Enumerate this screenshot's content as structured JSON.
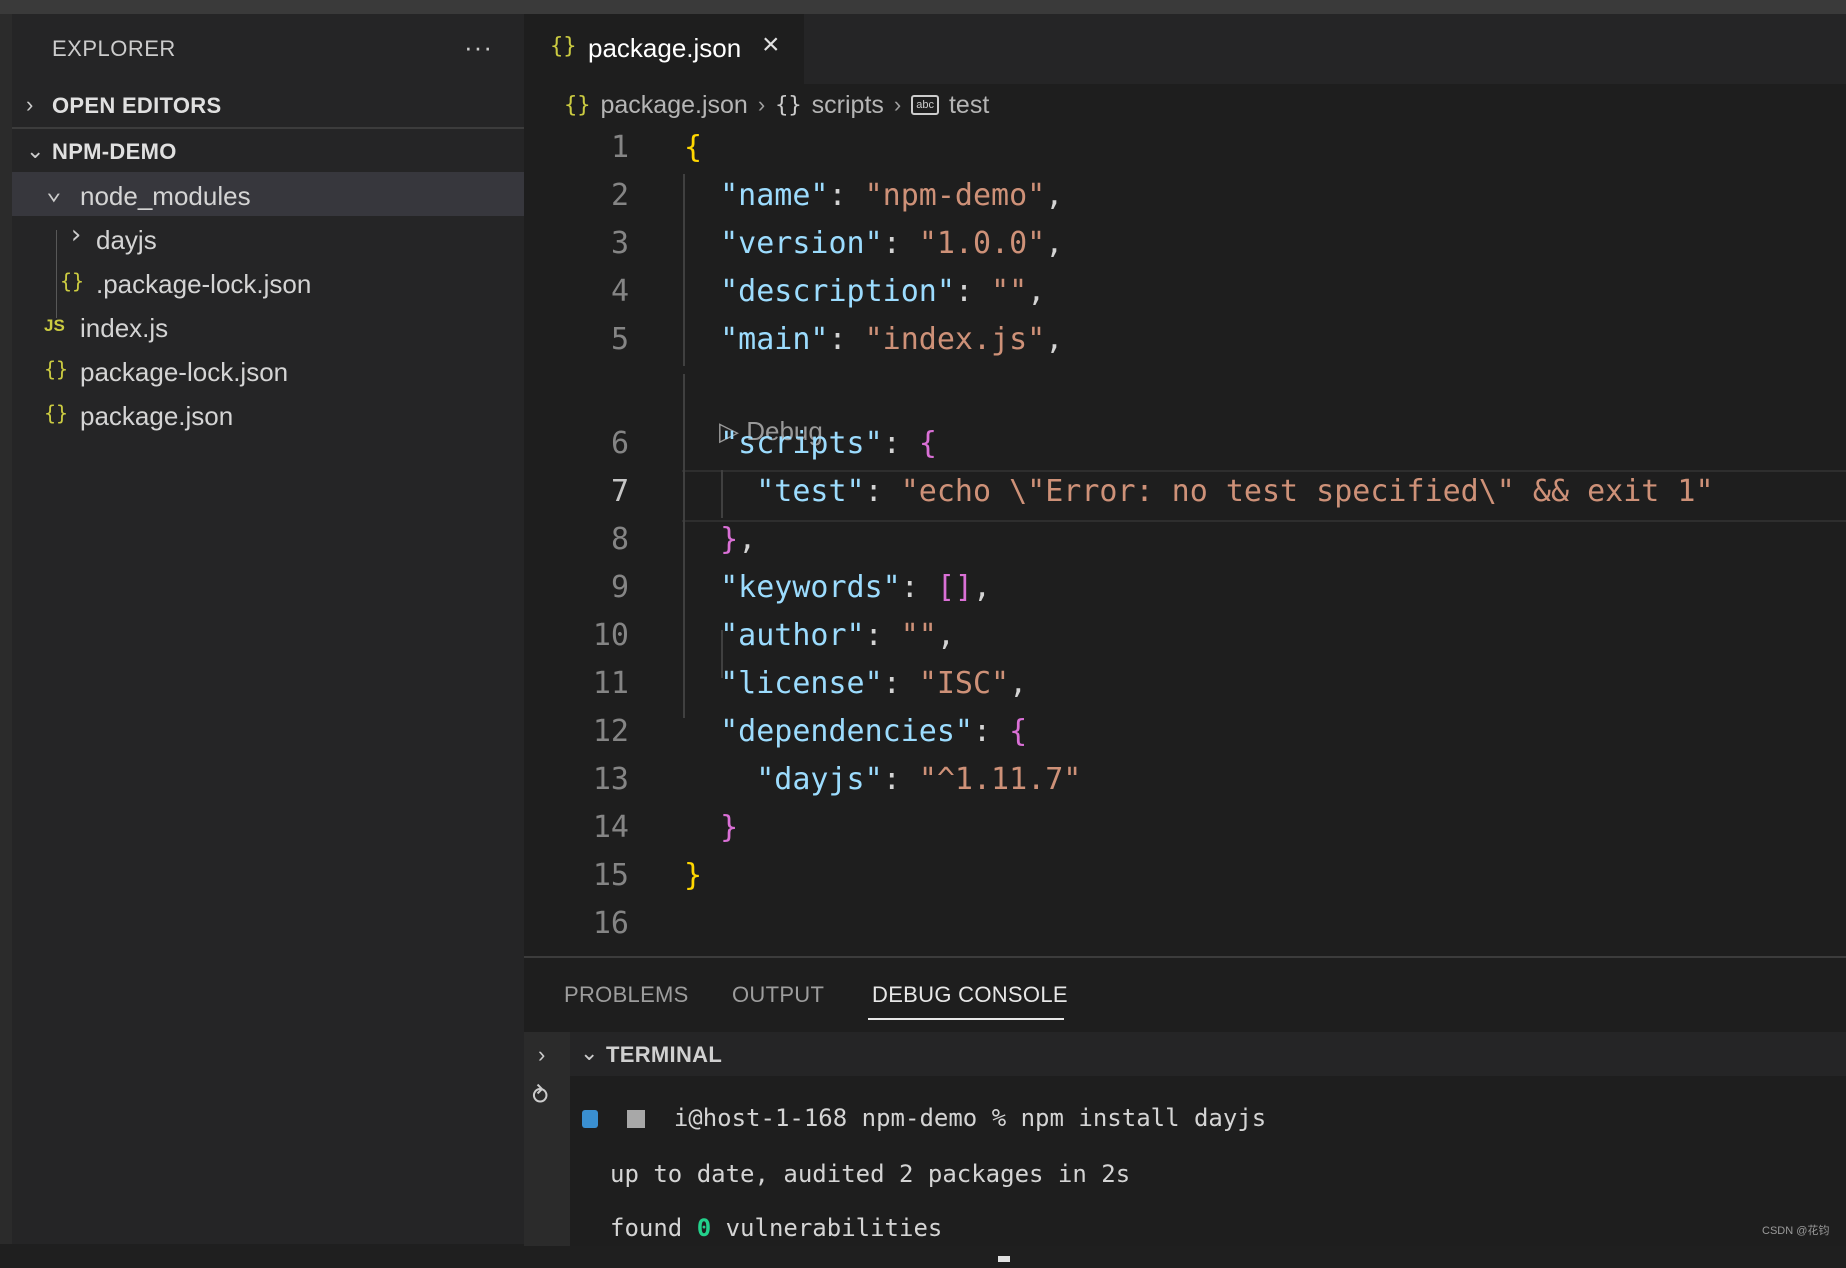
{
  "sidebar": {
    "title": "EXPLORER",
    "more": "···",
    "open_editors": "OPEN EDITORS",
    "project": "NPM-DEMO",
    "items": [
      {
        "label": "node_modules",
        "icon": "chevron-down"
      },
      {
        "label": "dayjs",
        "icon": "chevron-right"
      },
      {
        "label": ".package-lock.json",
        "icon": "{}"
      },
      {
        "label": "index.js",
        "icon": "JS"
      },
      {
        "label": "package-lock.json",
        "icon": "{}"
      },
      {
        "label": "package.json",
        "icon": "{}"
      }
    ]
  },
  "editor": {
    "tab": {
      "label": "package.json",
      "icon": "{}",
      "close": "×"
    },
    "breadcrumb": {
      "file": "package.json",
      "object": "scripts",
      "key": "test",
      "abc": "abc"
    },
    "debug_lens": "Debug",
    "line_numbers": [
      "1",
      "2",
      "3",
      "4",
      "5",
      "6",
      "7",
      "8",
      "9",
      "10",
      "11",
      "12",
      "13",
      "14",
      "15",
      "16"
    ],
    "lines": {
      "l1": {
        "brace": "{"
      },
      "l2": {
        "key": "\"name\"",
        "value": "\"npm-demo\""
      },
      "l3": {
        "key": "\"version\"",
        "value": "\"1.0.0\""
      },
      "l4": {
        "key": "\"description\"",
        "value": "\"\""
      },
      "l5": {
        "key": "\"main\"",
        "value": "\"index.js\""
      },
      "l6": {
        "key": "\"scripts\"",
        "brace": "{"
      },
      "l7": {
        "key": "\"test\"",
        "value": "\"echo \\\"Error: no test specified\\\" && exit 1\""
      },
      "l8": {
        "brace": "}"
      },
      "l9": {
        "key": "\"keywords\"",
        "value": "[]"
      },
      "l10": {
        "key": "\"author\"",
        "value": "\"\""
      },
      "l11": {
        "key": "\"license\"",
        "value": "\"ISC\""
      },
      "l12": {
        "key": "\"dependencies\"",
        "brace": "{"
      },
      "l13": {
        "key": "\"dayjs\"",
        "value": "\"^1.11.7\""
      },
      "l14": {
        "brace": "}"
      },
      "l15": {
        "brace": "}"
      }
    }
  },
  "panel": {
    "tabs": [
      "PROBLEMS",
      "OUTPUT",
      "DEBUG CONSOLE"
    ],
    "terminal_label": "TERMINAL",
    "terminal": {
      "prompt": "i@host-1-168 npm-demo % npm install dayjs",
      "line2": "up to date, audited 2 packages in 2s",
      "line3_pre": "found ",
      "line3_num": "0",
      "line3_post": " vulnerabilities"
    }
  },
  "watermark": "CSDN @花钧",
  "colors": {
    "key": "#9cdcfe",
    "string": "#ce9178",
    "brace_outer": "#ffd700",
    "brace_inner": "#da70d6",
    "json_icon": "#cbcb41"
  }
}
